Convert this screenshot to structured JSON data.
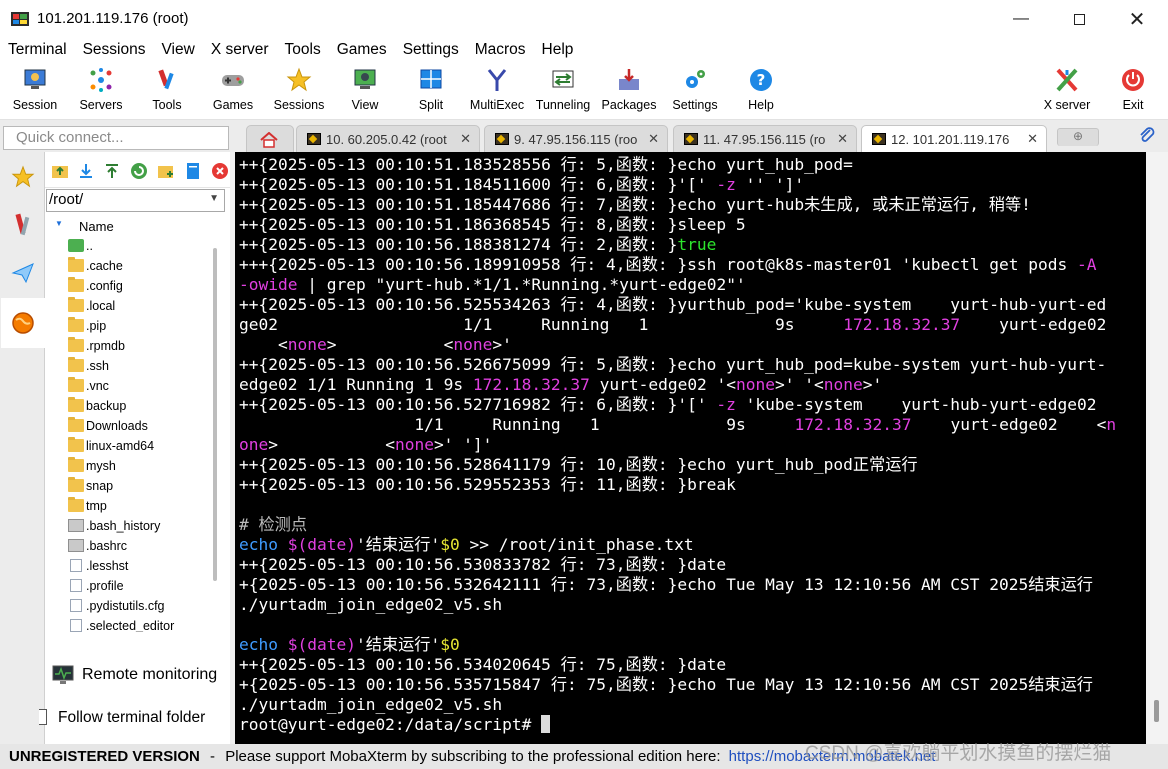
{
  "window": {
    "title": "101.201.119.176 (root)"
  },
  "menu": [
    "Terminal",
    "Sessions",
    "View",
    "X server",
    "Tools",
    "Games",
    "Settings",
    "Macros",
    "Help"
  ],
  "toolbar": {
    "session": "Session",
    "servers": "Servers",
    "tools": "Tools",
    "games": "Games",
    "sessions": "Sessions",
    "view": "View",
    "split": "Split",
    "multiexec": "MultiExec",
    "tunneling": "Tunneling",
    "packages": "Packages",
    "settings": "Settings",
    "help": "Help",
    "xserver": "X server",
    "exit": "Exit"
  },
  "quick_connect": {
    "placeholder": "Quick connect..."
  },
  "tabs": [
    {
      "label": "10. 60.205.0.42 (root"
    },
    {
      "label": "9. 47.95.156.115 (roo"
    },
    {
      "label": "11. 47.95.156.115 (ro"
    },
    {
      "label": "12. 101.201.119.176"
    }
  ],
  "sidebar": {
    "path": "/root/",
    "column": "Name",
    "items": [
      {
        "name": "..",
        "type": "up"
      },
      {
        "name": ".cache",
        "type": "folder"
      },
      {
        "name": ".config",
        "type": "folder"
      },
      {
        "name": ".local",
        "type": "folder"
      },
      {
        "name": ".pip",
        "type": "folder"
      },
      {
        "name": ".rpmdb",
        "type": "folder"
      },
      {
        "name": ".ssh",
        "type": "folder"
      },
      {
        "name": ".vnc",
        "type": "folder"
      },
      {
        "name": "backup",
        "type": "folder"
      },
      {
        "name": "Downloads",
        "type": "folder"
      },
      {
        "name": "linux-amd64",
        "type": "folder"
      },
      {
        "name": "mysh",
        "type": "folder"
      },
      {
        "name": "snap",
        "type": "folder"
      },
      {
        "name": "tmp",
        "type": "folder"
      },
      {
        "name": ".bash_history",
        "type": "graydoc"
      },
      {
        "name": ".bashrc",
        "type": "graydoc"
      },
      {
        "name": ".lesshst",
        "type": "file"
      },
      {
        "name": ".profile",
        "type": "file"
      },
      {
        "name": ".pydistutils.cfg",
        "type": "file"
      },
      {
        "name": ".selected_editor",
        "type": "file"
      }
    ],
    "remote_monitoring": "Remote monitoring",
    "follow_terminal": "Follow terminal folder"
  },
  "terminal": {
    "lines": [
      [
        {
          "t": "++{2025-05-13 00:10:51.183528556 行: 5,函数: }echo yurt_hub_pod="
        }
      ],
      [
        {
          "t": "++{2025-05-13 00:10:51.184511600 行: 6,函数: }'[' "
        },
        {
          "t": "-z",
          "c": "m"
        },
        {
          "t": " '' ']'"
        }
      ],
      [
        {
          "t": "++{2025-05-13 00:10:51.185447686 行: 7,函数: }echo yurt-hub未生成, 或未正常运行, 稍等!"
        }
      ],
      [
        {
          "t": "++{2025-05-13 00:10:51.186368545 行: 8,函数: }sleep 5"
        }
      ],
      [
        {
          "t": "++{2025-05-13 00:10:56.188381274 行: 2,函数: }"
        },
        {
          "t": "true",
          "c": "g"
        }
      ],
      [
        {
          "t": "+++{2025-05-13 00:10:56.189910958 行: 4,函数: }ssh root@k8s-master01 'kubectl get pods "
        },
        {
          "t": "-A",
          "c": "m"
        }
      ],
      [
        {
          "t": "-owide",
          "c": "m"
        },
        {
          "t": " | grep \"yurt-hub.*1/1.*Running.*yurt-edge02\"'"
        }
      ],
      [
        {
          "t": "++{2025-05-13 00:10:56.525534263 行: 4,函数: }yurthub_pod='kube-system    yurt-hub-yurt-ed"
        }
      ],
      [
        {
          "t": "ge02                   1/1     Running   1             9s     "
        },
        {
          "t": "172.18.32.37",
          "c": "m"
        },
        {
          "t": "    yurt-edge02"
        }
      ],
      [
        {
          "t": "    <"
        },
        {
          "t": "none",
          "c": "m"
        },
        {
          "t": ">           <"
        },
        {
          "t": "none",
          "c": "m"
        },
        {
          "t": ">'"
        }
      ],
      [
        {
          "t": "++{2025-05-13 00:10:56.526675099 行: 5,函数: }echo yurt_hub_pod=kube-system yurt-hub-yurt-"
        }
      ],
      [
        {
          "t": "edge02 1/1 Running 1 9s "
        },
        {
          "t": "172.18.32.37",
          "c": "m"
        },
        {
          "t": " yurt-edge02 '<"
        },
        {
          "t": "none",
          "c": "m"
        },
        {
          "t": ">' '<"
        },
        {
          "t": "none",
          "c": "m"
        },
        {
          "t": ">'"
        }
      ],
      [
        {
          "t": "++{2025-05-13 00:10:56.527716982 行: 6,函数: }'[' "
        },
        {
          "t": "-z",
          "c": "m"
        },
        {
          "t": " 'kube-system    yurt-hub-yurt-edge02"
        }
      ],
      [
        {
          "t": "                  1/1     Running   1             9s     "
        },
        {
          "t": "172.18.32.37",
          "c": "m"
        },
        {
          "t": "    yurt-edge02    <"
        },
        {
          "t": "n",
          "c": "m"
        }
      ],
      [
        {
          "t": "one",
          "c": "m"
        },
        {
          "t": ">           <"
        },
        {
          "t": "none",
          "c": "m"
        },
        {
          "t": ">' ']'"
        }
      ],
      [
        {
          "t": "++{2025-05-13 00:10:56.528641179 行: 10,函数: }echo yurt_hub_pod正常运行"
        }
      ],
      [
        {
          "t": "++{2025-05-13 00:10:56.529552353 行: 11,函数: }break"
        }
      ],
      [
        {
          "t": ""
        }
      ],
      [
        {
          "t": "# 检测点",
          "c": "gr"
        }
      ],
      [
        {
          "t": "echo",
          "c": "b"
        },
        {
          "t": " "
        },
        {
          "t": "$(date)",
          "c": "m"
        },
        {
          "t": "'结束运行'"
        },
        {
          "t": "$0",
          "c": "y"
        },
        {
          "t": " >> /root/init_phase.txt"
        }
      ],
      [
        {
          "t": "++{2025-05-13 00:10:56.530833782 行: 73,函数: }date"
        }
      ],
      [
        {
          "t": "+{2025-05-13 00:10:56.532642111 行: 73,函数: }echo Tue May 13 12:10:56 AM CST 2025结束运行"
        }
      ],
      [
        {
          "t": "./yurtadm_join_edge02_v5.sh"
        }
      ],
      [
        {
          "t": ""
        }
      ],
      [
        {
          "t": "echo",
          "c": "b"
        },
        {
          "t": " "
        },
        {
          "t": "$(date)",
          "c": "m"
        },
        {
          "t": "'结束运行'"
        },
        {
          "t": "$0",
          "c": "y"
        }
      ],
      [
        {
          "t": "++{2025-05-13 00:10:56.534020645 行: 75,函数: }date"
        }
      ],
      [
        {
          "t": "+{2025-05-13 00:10:56.535715847 行: 75,函数: }echo Tue May 13 12:10:56 AM CST 2025结束运行"
        }
      ],
      [
        {
          "t": "./yurtadm_join_edge02_v5.sh"
        }
      ],
      [
        {
          "t": "root@yurt-edge02:/data/script# "
        }
      ]
    ]
  },
  "status": {
    "unregistered": "UNREGISTERED VERSION",
    "separator": "-",
    "message": "Please support MobaXterm by subscribing to the professional edition here:",
    "link": "https://mobaxterm.mobatek.net"
  },
  "watermark": "CSDN @喜欢躺平划水摸鱼的摆烂猫"
}
